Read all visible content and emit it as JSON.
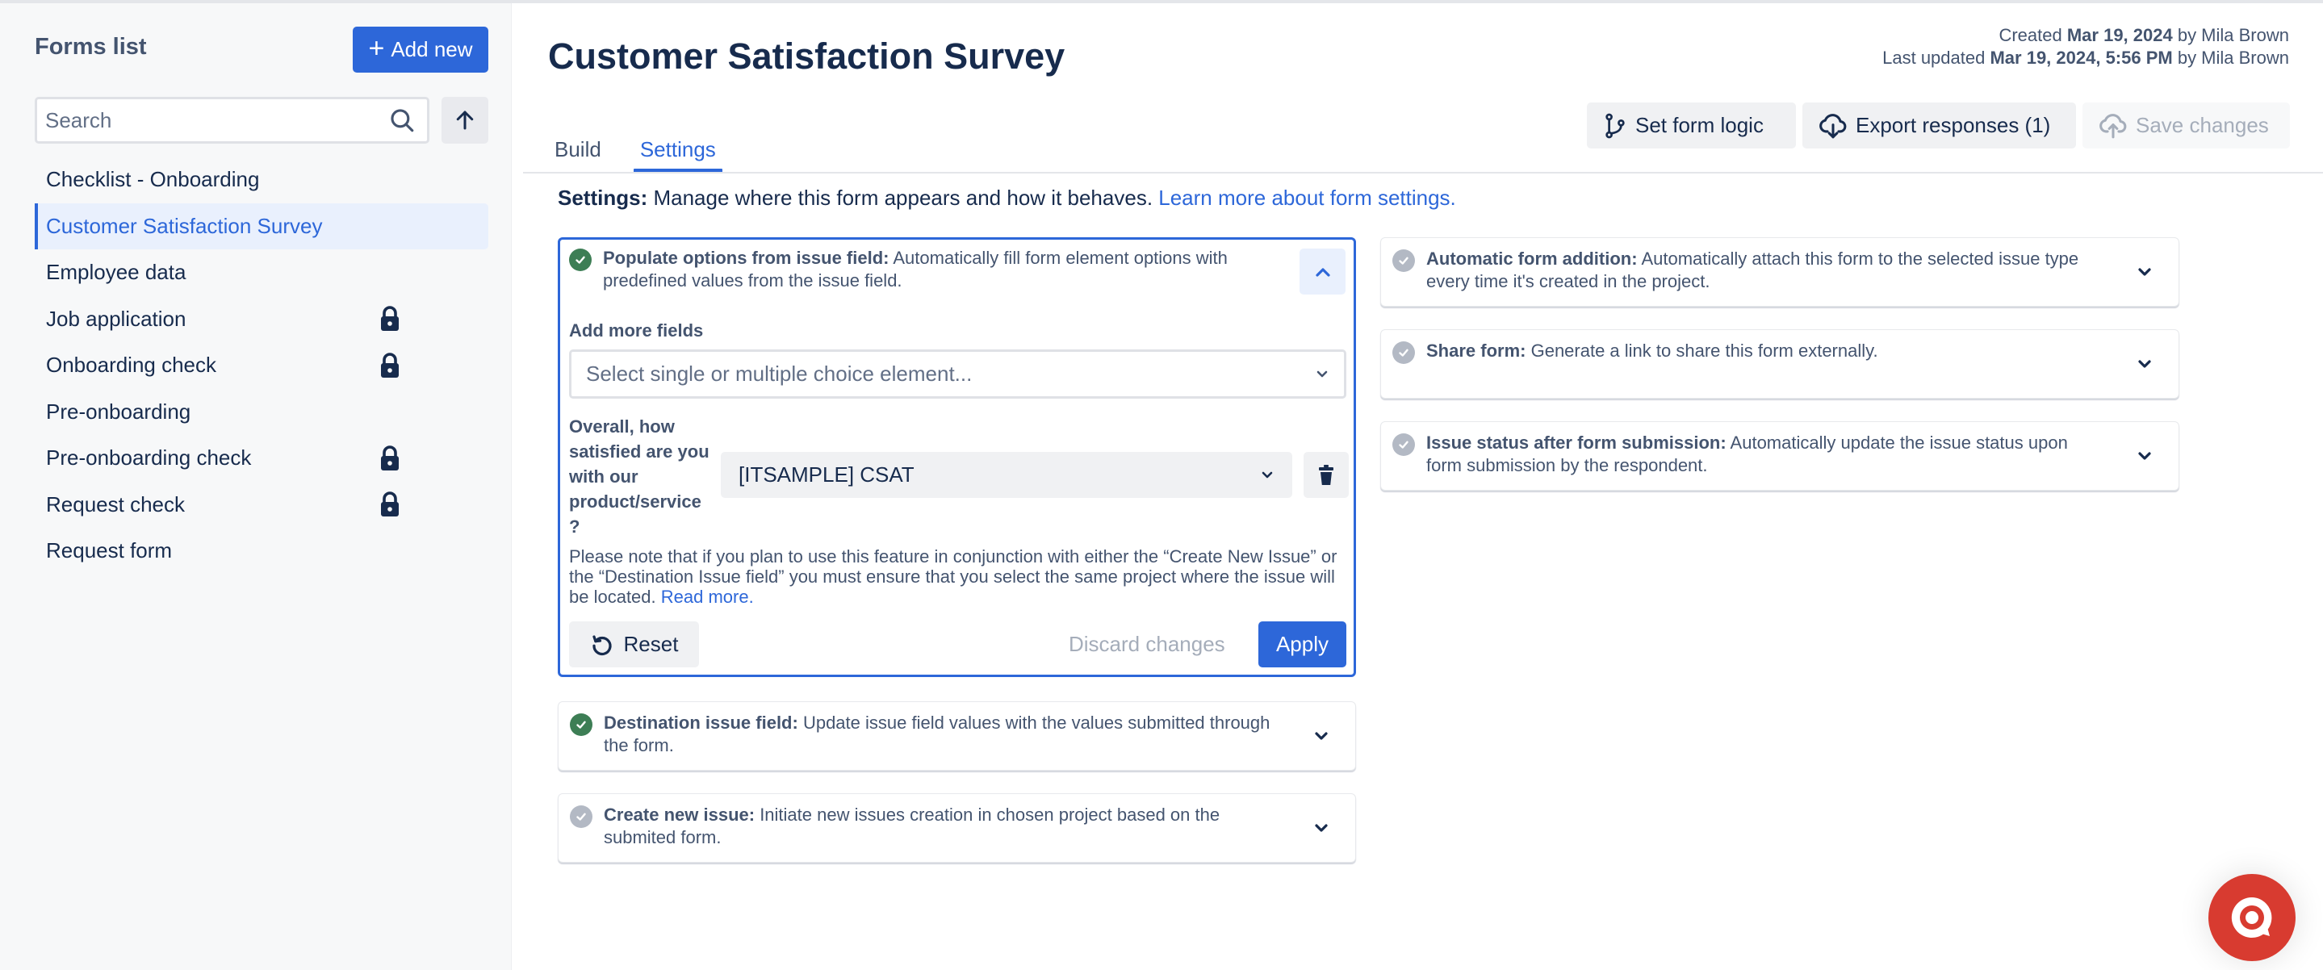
{
  "sidebar": {
    "title": "Forms list",
    "add_new_label": "Add new",
    "search_placeholder": "Search",
    "items": [
      {
        "label": "Checklist - Onboarding",
        "locked": false,
        "selected": false
      },
      {
        "label": "Customer Satisfaction Survey",
        "locked": false,
        "selected": true
      },
      {
        "label": "Employee data",
        "locked": false,
        "selected": false
      },
      {
        "label": "Job application",
        "locked": true,
        "selected": false
      },
      {
        "label": "Onboarding check",
        "locked": true,
        "selected": false
      },
      {
        "label": "Pre-onboarding",
        "locked": false,
        "selected": false
      },
      {
        "label": "Pre-onboarding check",
        "locked": true,
        "selected": false
      },
      {
        "label": "Request check",
        "locked": true,
        "selected": false
      },
      {
        "label": "Request form",
        "locked": false,
        "selected": false
      }
    ]
  },
  "header": {
    "title": "Customer Satisfaction Survey",
    "created_prefix": "Created ",
    "created_date": "Mar 19, 2024",
    "created_by": " by Mila Brown",
    "updated_prefix": "Last updated ",
    "updated_date": "Mar 19, 2024, 5:56 PM",
    "updated_by": " by Mila Brown",
    "buttons": {
      "set_form_logic": "Set form logic",
      "export_responses": "Export responses (1)",
      "save_changes": "Save changes"
    }
  },
  "tabs": [
    {
      "label": "Build",
      "active": false
    },
    {
      "label": "Settings",
      "active": true
    }
  ],
  "settings": {
    "intro_bold": "Settings:",
    "intro_text": " Manage where this form appears and how it behaves. ",
    "intro_link": "Learn more about form settings.",
    "populate": {
      "title": "Populate options from issue field:",
      "desc": " Automatically fill form element options with predefined values from the issue field.",
      "enabled": true,
      "add_more_label": "Add more fields",
      "select_placeholder": "Select single or multiple choice element...",
      "question_label": "Overall, how satisfied are you with our product/service ?",
      "mapped_field": "[ITSAMPLE] CSAT",
      "note": "Please note that if you plan to use this feature in conjunction with either the “Create New Issue” or the “Destination Issue field” you must ensure that you select the same project where the issue will be located. ",
      "note_link": "Read more.",
      "reset_label": "Reset",
      "discard_label": "Discard changes",
      "apply_label": "Apply"
    },
    "left_cards": [
      {
        "title": "Destination issue field:",
        "desc": " Update issue field values with the values submitted through the form.",
        "enabled": true
      },
      {
        "title": "Create new issue:",
        "desc": " Initiate new issues creation in chosen project based on the submited form.",
        "enabled": false
      }
    ],
    "right_cards": [
      {
        "title": "Automatic form addition:",
        "desc": " Automatically attach this form to the selected issue type every time it's created in the project.",
        "enabled": false
      },
      {
        "title": "Share form:",
        "desc": " Generate a link to share this form externally.",
        "enabled": false
      },
      {
        "title": "Issue status after form submission:",
        "desc": " Automatically update the issue status upon form submission by the respondent.",
        "enabled": false
      }
    ]
  },
  "colors": {
    "accent": "#2d67d9",
    "success": "#3d7e55",
    "disabled_check": "#b3b9c4",
    "chat": "#d83b30"
  }
}
